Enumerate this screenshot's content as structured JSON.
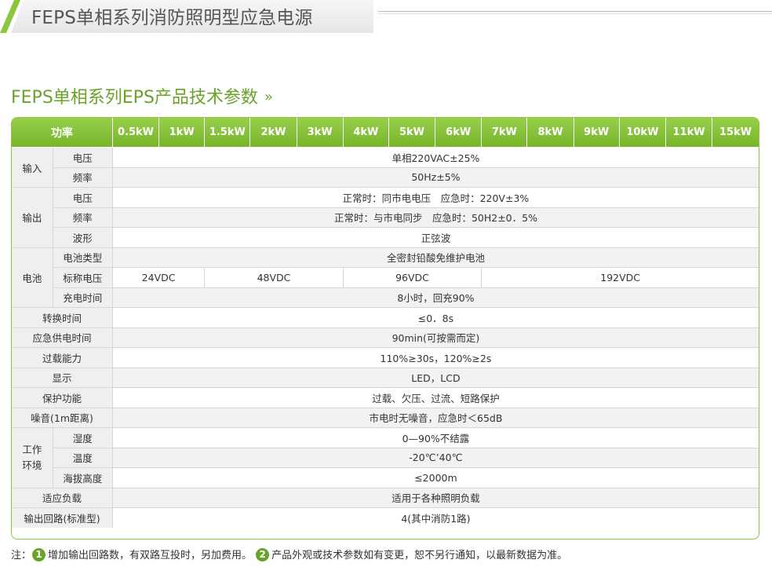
{
  "header": {
    "title": "FEPS单相系列消防照明型应急电源",
    "section_title": "FEPS单相系列EPS产品技术参数",
    "section_arrows": "»"
  },
  "table": {
    "power_label": "功率",
    "powers": [
      "0.5kW",
      "1kW",
      "1.5kW",
      "2kW",
      "3kW",
      "4kW",
      "5kW",
      "6kW",
      "7kW",
      "8kW",
      "9kW",
      "10kW",
      "11kW",
      "15kW"
    ],
    "input": {
      "label": "输入",
      "voltage_label": "电压",
      "voltage": "单相220VAC±25%",
      "freq_label": "频率",
      "freq": "50Hz±5%"
    },
    "output": {
      "label": "输出",
      "voltage_label": "电压",
      "voltage": "正常时：同市电电压　应急时：220V±3%",
      "freq_label": "频率",
      "freq": "正常时：与市电同步　应急时：50H2±0．5%",
      "wave_label": "波形",
      "wave": "正弦波"
    },
    "battery": {
      "label": "电池",
      "type_label": "电池类型",
      "type": "全密封铅酸免维护电池",
      "voltage_label": "标称电压",
      "voltages": [
        "24VDC",
        "48VDC",
        "96VDC",
        "192VDC"
      ],
      "charge_label": "充电时间",
      "charge": "8小时，回充90%"
    },
    "switch_label": "转换时间",
    "switch": "≤0．8s",
    "supply_label": "应急供电时间",
    "supply": "90min(可按需而定)",
    "overload_label": "过载能力",
    "overload": "110%≥30s，120%≥2s",
    "display_label": "显示",
    "display": "LED，LCD",
    "protect_label": "保护功能",
    "protect": "过载、欠压、过流、短路保护",
    "noise_label": "噪音(1m距离)",
    "noise": "市电时无噪音，应急时＜65dB",
    "env": {
      "label_1": "工作",
      "label_2": "环境",
      "humidity_label": "湿度",
      "humidity": "0—90%不结露",
      "temp_label": "温度",
      "temp": "-20℃’40℃",
      "altitude_label": "海拔高度",
      "altitude": "≤2000m"
    },
    "load_label": "适应负载",
    "load": "适用于各种照明负载",
    "circuit_label": "输出回路(标准型)",
    "circuit": "4(其中消防1路)"
  },
  "note": {
    "prefix": "注：",
    "n1": "1",
    "text1": "增加输出回路数，有双路互投时，另加费用。",
    "n2": "2",
    "text2": "产品外观或技术参数如有变更，恕不另行通知，以最新数据为准。"
  },
  "colors": {
    "accent": "#8cc63f",
    "title_green": "#6aa32a",
    "row_gray": "#efefef"
  }
}
